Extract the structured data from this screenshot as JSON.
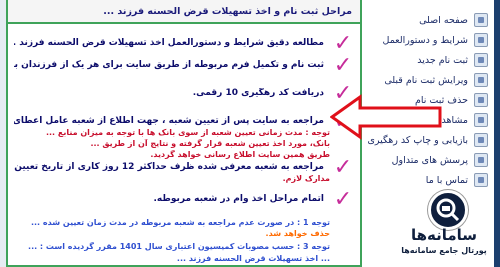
{
  "panel": {
    "header": "مراحل ثبت نام و اخذ تسهیلات قرض الحسنه فرزند ..."
  },
  "steps": [
    {
      "text": "مطالعه دقیق شرایط و دستورالعمل اخذ تسهیلات قرض الحسنه فرزند ..."
    },
    {
      "text": "ثبت نام و تکمیل فرم مربوطه از طریق سایت برای هر یک از فرزندان بصور..."
    },
    {
      "text": "دریافت کد رهگیری 10 رقمی."
    },
    {
      "text": "مراجعه به سایت پس از تعیین شعبه ، جهت اطلاع از شعبه عامل اعطای ..."
    },
    {
      "text": "مراجعه به شعبه معرفی شده ظرف حداکثر 12 روز کاری از تاریخ تعیین شعب..."
    },
    {
      "text": "اتمام مراحل اخذ وام در شعبه مربوطه."
    }
  ],
  "notes": {
    "step4_note_1": "توجه : مدت زمانی تعیین شعبه از سوی بانک ها با توجه به میزان منابع ...",
    "step4_note_2": "بانک، مورد اخذ تعیین شعبه قرار گرفته و نتایج آن از طریق ...",
    "step4_note_3": "طریق همین سایت اطلاع رسانی خواهد گردید.",
    "step5_note": "مدارک لازم.",
    "bottom_1": "توجه 1 : در صورت عدم مراجعه به شعبه مربوطه در مدت زمان تعیین شده ...",
    "bottom_2": "حذف خواهد شد.",
    "bottom_3": "توجه 3 : حسب مصوبات کمیسیون اعتباری سال 1401 مقرر گردیده است : ...",
    "bottom_4": "... اخذ تسهیلات قرض الحسنه فرزند ..."
  },
  "sidebar": {
    "items": [
      {
        "label": "صفحه اصلی",
        "icon": "home-icon"
      },
      {
        "label": "شرایط و دستورالعمل",
        "icon": "document-icon"
      },
      {
        "label": "ثبت نام جدید",
        "icon": "register-icon"
      },
      {
        "label": "ویرایش ثبت نام قبلی",
        "icon": "edit-icon"
      },
      {
        "label": "حذف ثبت نام",
        "icon": "delete-icon"
      },
      {
        "label": "مشاهده وضعیت",
        "icon": "status-icon"
      },
      {
        "label": "بازیابی و چاپ کد رهگیری",
        "icon": "print-icon"
      },
      {
        "label": "پرسش های متداول",
        "icon": "faq-icon"
      },
      {
        "label": "تماس با ما",
        "icon": "contact-icon"
      }
    ]
  },
  "watermark": {
    "title": "سامانه‌ها",
    "subtitle": "پورتال جامع سامانه‌ها"
  },
  "colors": {
    "border": "#3fa35a",
    "check": "#c62c9a",
    "arrow": "#e0101a",
    "text": "#0d0d6b"
  }
}
